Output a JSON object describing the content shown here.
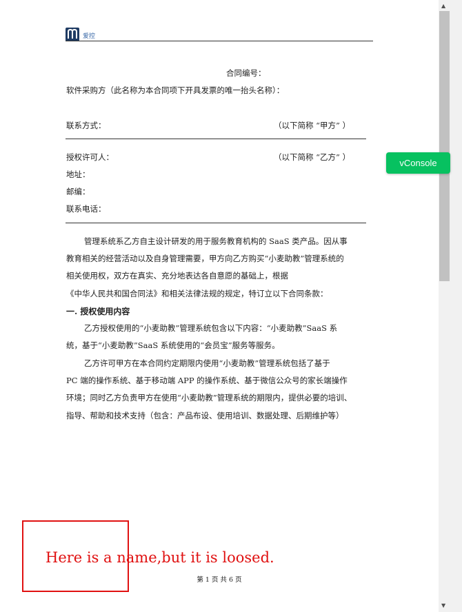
{
  "header": {
    "brand": "爱控"
  },
  "contract": {
    "number_label": "合同编号：",
    "buyer_label": "软件采购方（此名称为本合同项下开具发票的唯一抬头名称）：",
    "contact_label": "联系方式：",
    "party_a_alias": "（以下简称 “甲方” ）",
    "licensor_label": "授权许可人：",
    "party_b_alias": "（以下简称 “乙方” ）",
    "address_label": "地址：",
    "postcode_label": "邮编：",
    "phone_label": "联系电话："
  },
  "body": {
    "intro_line1": "管理系统系乙方自主设计研发的用于服务教育机构的 SaaS 类产品。因从事",
    "intro_line2": "教育相关的经营活动以及自身管理需要，甲方向乙方购买“小麦助教”管理系统的",
    "intro_line3": "相关使用权，双方在真实、充分地表达各自意愿的基础上，根据",
    "intro_line4": "《中华人民共和国合同法》和相关法律法规的规定，特订立以下合同条款：",
    "section1_title": "一. 授权使用内容",
    "sec1_p1_line1": "乙方授权使用的“小麦助教”管理系统包含以下内容：“小麦助教”SaaS 系",
    "sec1_p1_line2": "统，基于“小麦助教”SaaS 系统使用的“会员宝”服务等服务。",
    "sec1_p2_line1": "乙方许可甲方在本合同约定期限内使用“小麦助教”管理系统包括了基于",
    "sec1_p2_line2": "PC 端的操作系统、基于移动端 APP 的操作系统、基于微信公众号的家长端操作",
    "sec1_p2_line3": "环境；同时乙方负责甲方在使用“小麦助教”管理系统的期限内，提供必要的培训、",
    "sec1_p2_line4": "指导、帮助和技术支持（包含：产品布设、使用培训、数据处理、后期维护等）"
  },
  "annotation": {
    "text": "Here is a name,but it is loosed.",
    "color": "#e01010"
  },
  "footer": {
    "page_label": "第 1 页 共 6 页"
  },
  "vconsole": {
    "label": "vConsole",
    "color": "#07c160"
  }
}
